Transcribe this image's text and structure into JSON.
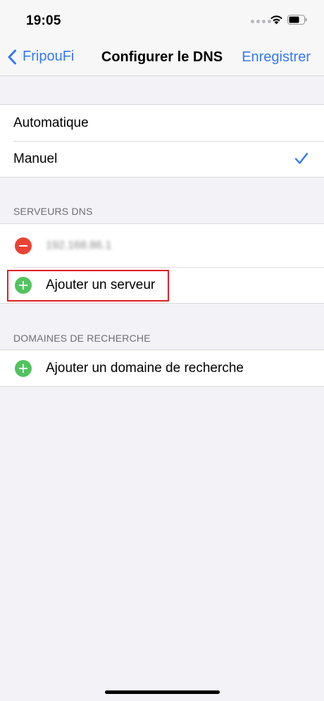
{
  "status_bar": {
    "time": "19:05",
    "icons": [
      "signal-dots-icon",
      "wifi-icon",
      "battery-icon"
    ]
  },
  "nav": {
    "back_label": "FripouFi",
    "title": "Configurer le DNS",
    "save_label": "Enregistrer"
  },
  "dns_mode": {
    "options": [
      {
        "label": "Automatique",
        "selected": false
      },
      {
        "label": "Manuel",
        "selected": true
      }
    ]
  },
  "dns_servers": {
    "header": "SERVEURS DNS",
    "servers": [
      "192.168.86.1"
    ],
    "add_label": "Ajouter un serveur"
  },
  "search_domains": {
    "header": "DOMAINES DE RECHERCHE",
    "add_label": "Ajouter un domaine de recherche"
  },
  "colors": {
    "accent": "#3478f6",
    "add": "#52c35f",
    "remove": "#ea4335",
    "highlight": "#e01f26",
    "background": "#f2f2f7"
  }
}
